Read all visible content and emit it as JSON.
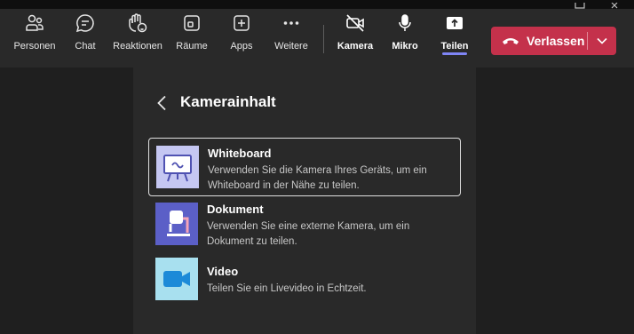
{
  "toolbar": {
    "items": [
      {
        "label": "Personen",
        "icon": "people-icon"
      },
      {
        "label": "Chat",
        "icon": "chat-icon"
      },
      {
        "label": "Reaktionen",
        "icon": "raise-hand-icon"
      },
      {
        "label": "Räume",
        "icon": "rooms-icon"
      },
      {
        "label": "Apps",
        "icon": "apps-plus-icon"
      },
      {
        "label": "Weitere",
        "icon": "more-icon"
      },
      {
        "label": "Kamera",
        "icon": "camera-off-icon"
      },
      {
        "label": "Mikro",
        "icon": "microphone-icon"
      },
      {
        "label": "Teilen",
        "icon": "share-icon"
      }
    ],
    "leave_label": "Verlassen"
  },
  "panel": {
    "title": "Kamerainhalt",
    "options": [
      {
        "title": "Whiteboard",
        "desc_line1": "Verwenden Sie die Kamera Ihres Geräts, um ein",
        "desc_line2": "Whiteboard in der Nähe zu teilen."
      },
      {
        "title": "Dokument",
        "desc_line1": "Verwenden Sie eine externe Kamera, um ein",
        "desc_line2": "Dokument zu teilen."
      },
      {
        "title": "Video",
        "desc_line1": "Teilen Sie ein Livevideo in Echtzeit."
      }
    ]
  },
  "colors": {
    "leave": "#c4314b",
    "accent": "#7f85f5",
    "whiteboard_tile": "#c5c7f2",
    "document_tile": "#5b5fc7",
    "video_tile": "#a8e0ef"
  }
}
